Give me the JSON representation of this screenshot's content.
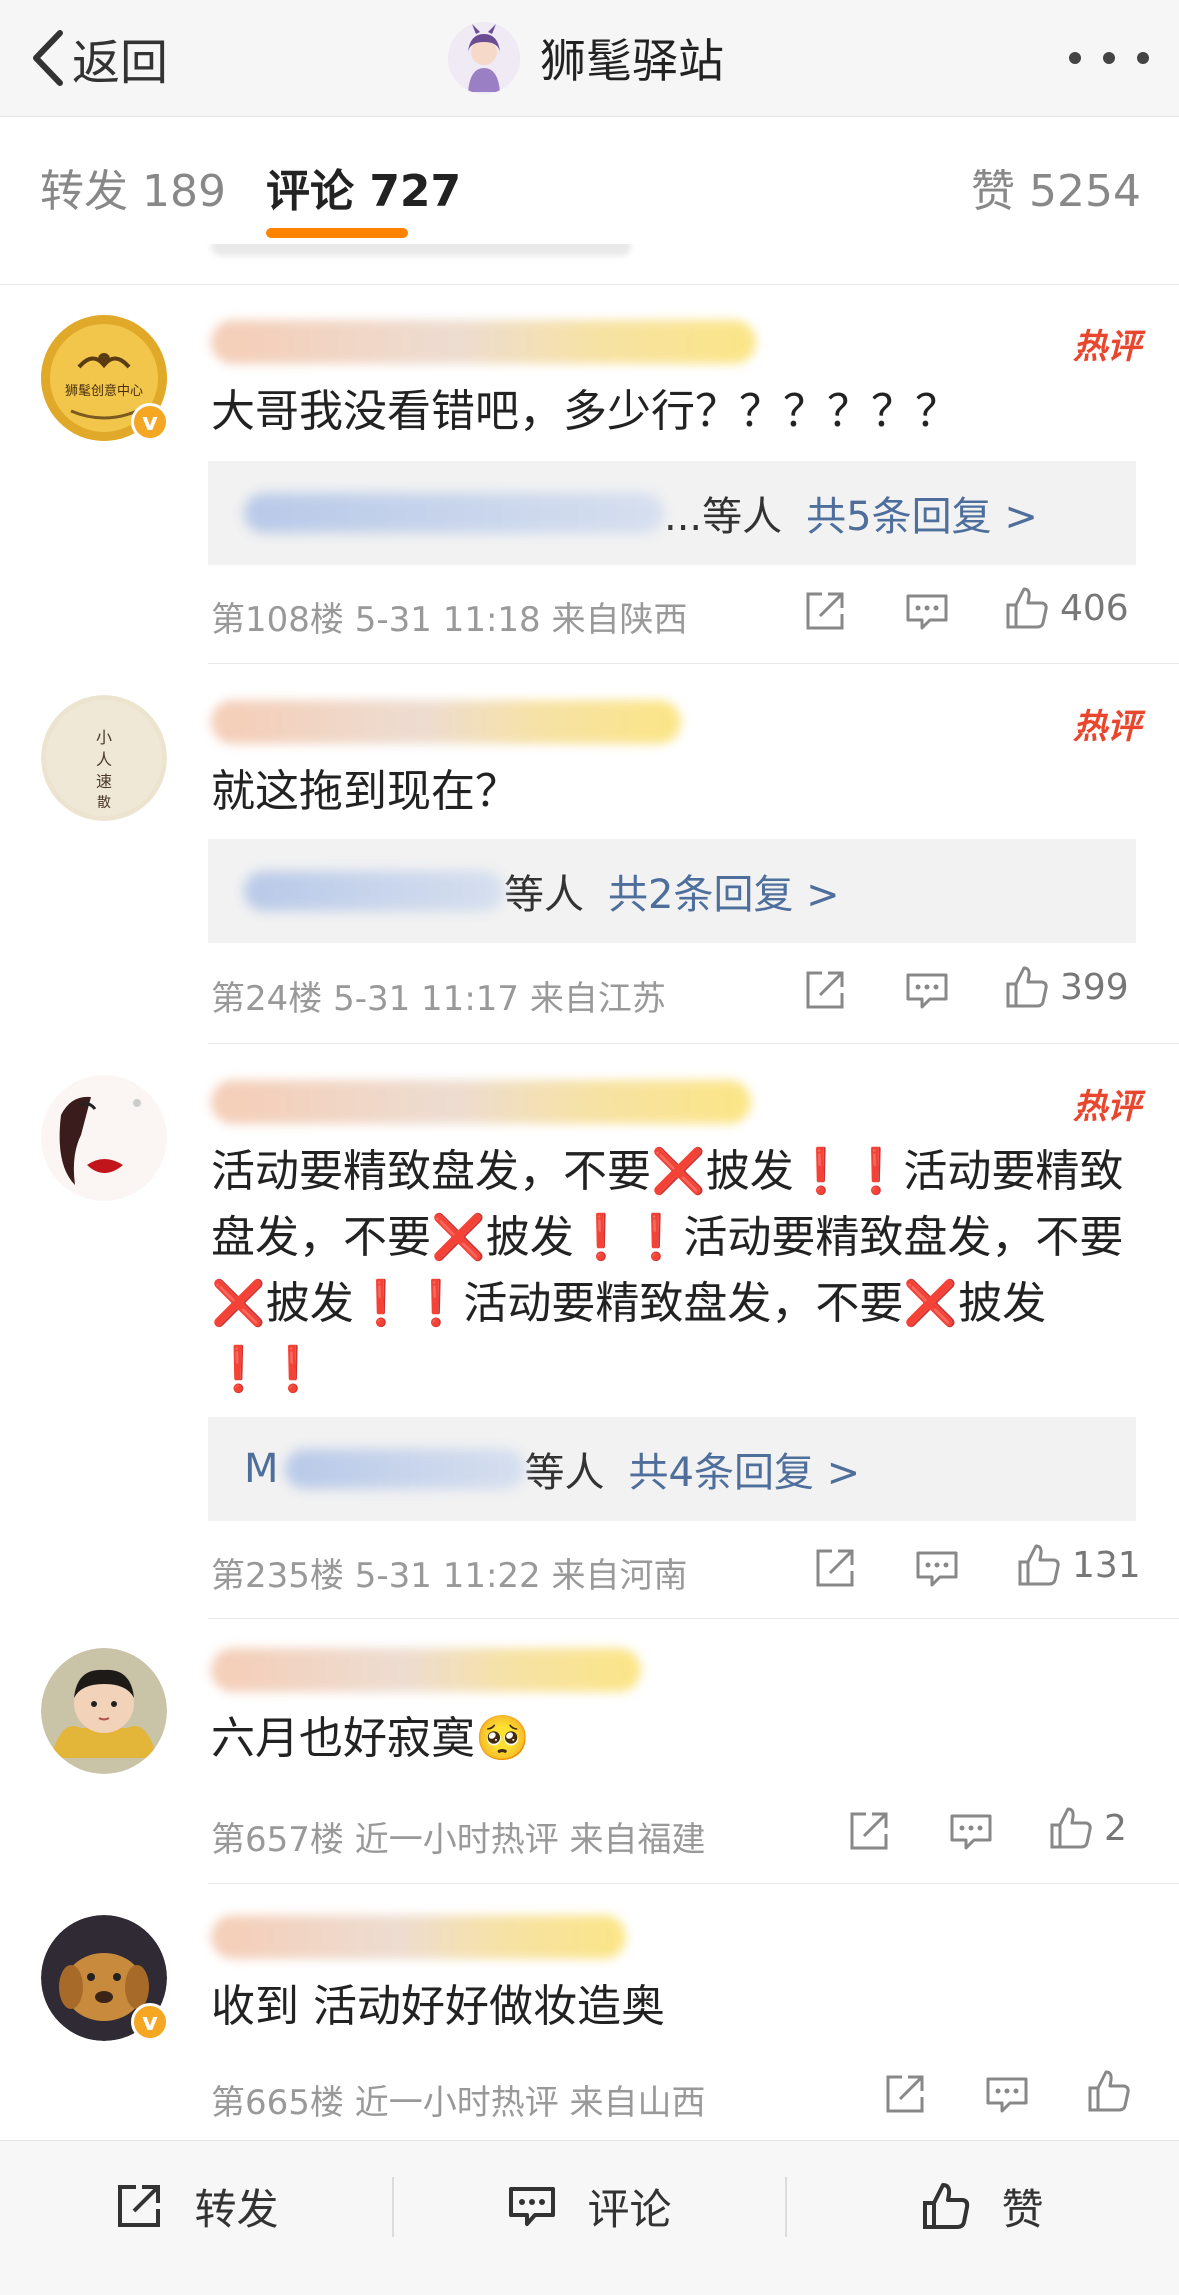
{
  "nav": {
    "back_label": "返回",
    "title": "狮髦驿站"
  },
  "tabs": {
    "repost_label": "转发 189",
    "comment_label": "评论 727",
    "like_label": "赞 5254"
  },
  "hot_badge": "热评",
  "comments": [
    {
      "avatar_text": "狮髦创意中心",
      "verified": "v",
      "text": "大哥我没看错吧，多少行？？？？？？",
      "reply_suffix": "...等人",
      "reply_link": "共5条回复 >",
      "floor": "第108楼",
      "time": "5-31 11:18",
      "location": "来自陕西",
      "likes": "406"
    },
    {
      "avatar_text": "小人速散",
      "text": "就这拖到现在？",
      "reply_suffix": "等人",
      "reply_link": "共2条回复 >",
      "floor": "第24楼",
      "time": "5-31 11:17",
      "location": "来自江苏",
      "likes": "399"
    },
    {
      "text": "活动要精致盘发，不要❌披发❗️❗️活动要精致盘发，不要❌披发❗️❗️活动要精致盘发，不要❌披发❗️❗️活动要精致盘发，不要❌披发❗️❗️",
      "reply_prefix": "M",
      "reply_suffix": "等人",
      "reply_link": "共4条回复 >",
      "floor": "第235楼",
      "time": "5-31 11:22",
      "location": "来自河南",
      "likes": "131"
    },
    {
      "text": "六月也好寂寞🥺",
      "floor": "第657楼",
      "time": "近一小时热评",
      "location": "来自福建",
      "likes": "2"
    },
    {
      "verified": "v",
      "text": "收到 活动好好做妆造奥",
      "floor": "第665楼",
      "time": "近一小时热评",
      "location": "来自山西",
      "likes": ""
    }
  ],
  "bottom_bar": {
    "repost": "转发",
    "comment": "评论",
    "like": "赞"
  },
  "colors": {
    "accent": "#ff8200",
    "link": "#4e6e9c",
    "hot": "#e8462d",
    "verified": "#f5a623"
  }
}
